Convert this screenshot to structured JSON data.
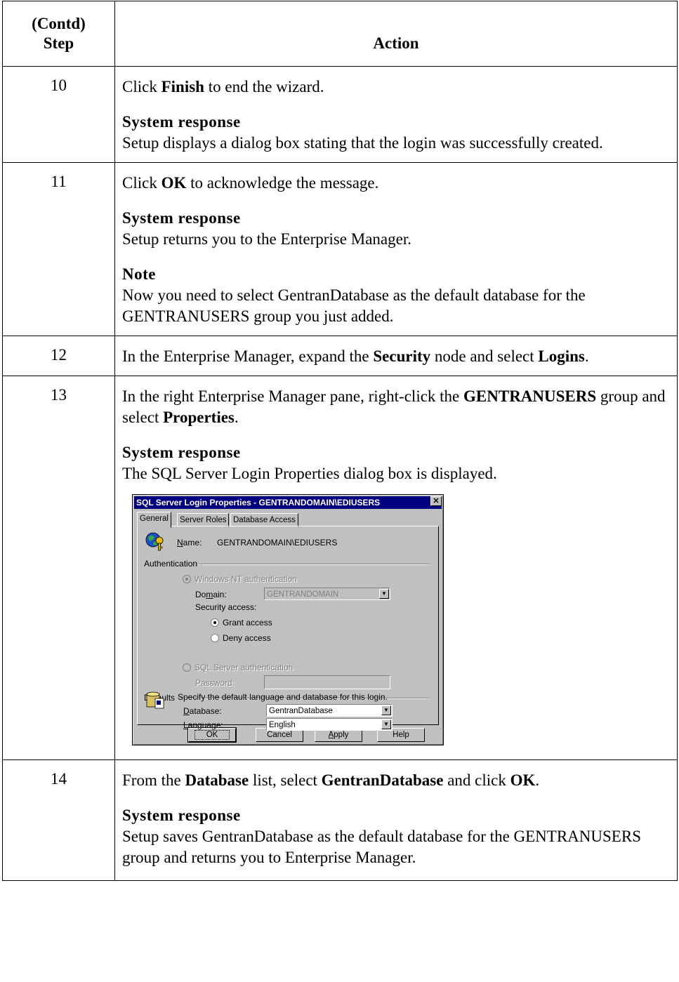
{
  "header": {
    "step_top": "(Contd)",
    "step_bottom": "Step",
    "action": "Action"
  },
  "labels": {
    "system_response": "System response",
    "note": "Note"
  },
  "rows": [
    {
      "num": "10",
      "parts": [
        "Click ",
        "Finish",
        " to end the wizard."
      ],
      "response": "Setup displays a dialog box stating that the login was successfully created."
    },
    {
      "num": "11",
      "parts": [
        "Click ",
        "OK",
        " to acknowledge the message."
      ],
      "response": "Setup returns you to the Enterprise Manager.",
      "note": "Now you need to select GentranDatabase as the default database for the GENTRANUSERS group you just added."
    },
    {
      "num": "12",
      "parts": [
        "In the Enterprise Manager, expand the ",
        "Security",
        " node and select ",
        "Logins",
        "."
      ]
    },
    {
      "num": "13",
      "parts": [
        "In the right Enterprise Manager pane, right-click the ",
        "GENTRANUSERS",
        " group and select ",
        "Properties",
        "."
      ],
      "response": "The SQL Server Login Properties dialog box is displayed."
    },
    {
      "num": "14",
      "parts": [
        "From the ",
        "Database",
        " list, select ",
        "GentranDatabase",
        " and click ",
        "OK",
        "."
      ],
      "response": "Setup saves GentranDatabase as the default database for the GENTRANUSERS group and returns you to Enterprise Manager."
    }
  ],
  "dialog": {
    "title": "SQL Server Login Properties - GENTRANDOMAIN\\EDIUSERS",
    "close": "✕",
    "tabs": [
      "General",
      "Server Roles",
      "Database Access"
    ],
    "name_label": "Name:",
    "name_value": "GENTRANDOMAIN\\EDIUSERS",
    "authentication": "Authentication",
    "windows_nt": "Windows NT authentication",
    "domain_label": "Domain:",
    "domain_value": "GENTRANDOMAIN",
    "security_access": "Security access:",
    "grant": "Grant access",
    "deny": "Deny access",
    "sql_auth": "SQL Server authentication",
    "password_label": "Password:",
    "defaults": "Defaults",
    "defaults_desc": "Specify the default language and database for this login.",
    "database_label": "Database:",
    "database_value": "GentranDatabase",
    "language_label": "Language:",
    "language_value": "English",
    "buttons": {
      "ok": "OK",
      "cancel": "Cancel",
      "apply": "Apply",
      "help": "Help"
    }
  }
}
